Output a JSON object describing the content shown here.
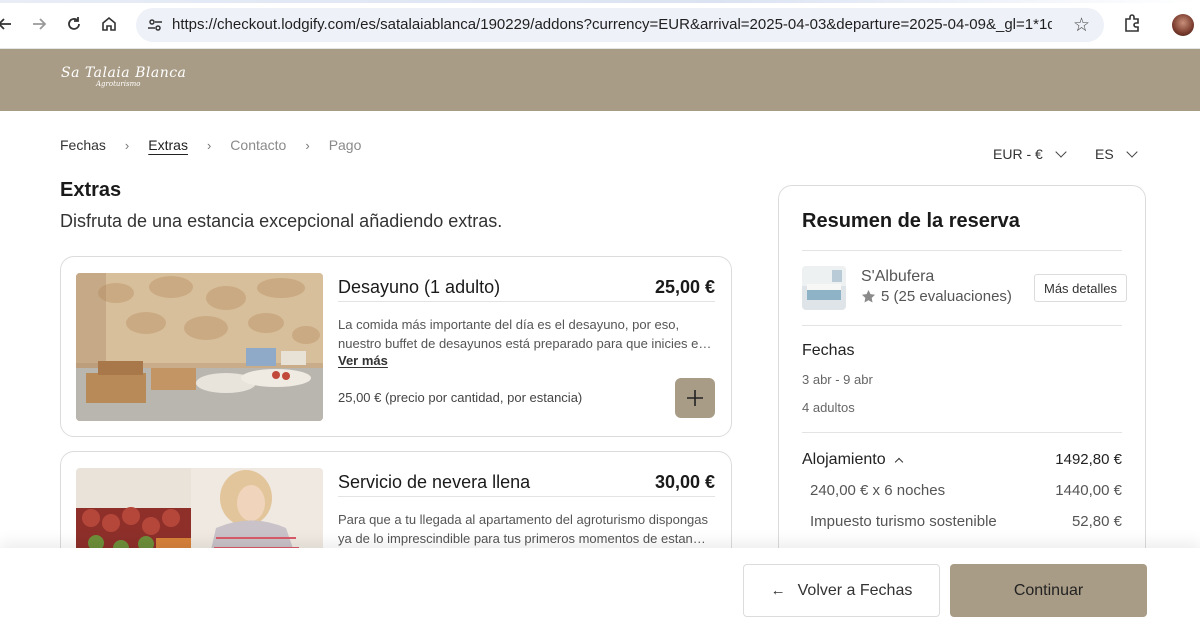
{
  "browser": {
    "url": "https://checkout.lodgify.com/es/satalaiablanca/190229/addons?currency=EUR&arrival=2025-04-03&departure=2025-04-09&_gl=1*1dp8r4s*_g..."
  },
  "site": {
    "logo_text": "Sa Talaia Blanca",
    "logo_subtext": "Agroturismo"
  },
  "breadcrumb": {
    "steps": [
      "Fechas",
      "Extras",
      "Contacto",
      "Pago"
    ]
  },
  "selectors": {
    "currency": "EUR - €",
    "language": "ES"
  },
  "main": {
    "title": "Extras",
    "subtitle": "Disfruta de una estancia excepcional añadiendo extras."
  },
  "extras": [
    {
      "title": "Desayuno (1 adulto)",
      "price": "25,00 €",
      "desc_line1": "La comida más importante del día es el desayuno, por eso,",
      "desc_line2": "nuestro buffet de desayunos está preparado para que inicies el…",
      "see_more": "Ver más",
      "price_note": "25,00 € (precio por cantidad, por estancia)"
    },
    {
      "title": "Servicio de nevera llena",
      "price": "30,00 €",
      "desc_line1": "Para que a tu llegada al apartamento del agroturismo dispongas",
      "desc_line2": "ya de lo imprescindible para tus primeros momentos de estanci…"
    }
  ],
  "summary": {
    "title": "Resumen de la reserva",
    "property_name": "S'Albufera",
    "rating": "5 (25 evaluaciones)",
    "details_button": "Más detalles",
    "dates_label": "Fechas",
    "dates_value": "3 abr - 9 abr",
    "guests_value": "4 adultos",
    "accommodation_label": "Alojamiento",
    "accommodation_total": "1492,80 €",
    "nights_label": "240,00 € x 6 noches",
    "nights_amount": "1440,00 €",
    "tax_label": "Impuesto turismo sostenible",
    "tax_amount": "52,80 €"
  },
  "footer": {
    "back_label": "Volver a Fechas",
    "continue_label": "Continuar"
  },
  "colors": {
    "brand": "#a99c86"
  }
}
